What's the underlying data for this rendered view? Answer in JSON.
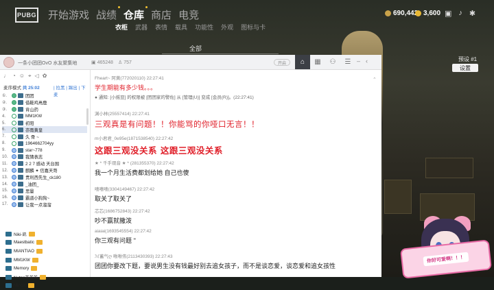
{
  "game": {
    "logo": "PUBG",
    "main_tabs": [
      "开始游戏",
      "战绩",
      "仓库",
      "商店",
      "电竞"
    ],
    "sub_tabs": [
      "衣柜",
      "武器",
      "表情",
      "载具",
      "功能性",
      "外观",
      "图标与卡"
    ],
    "currency_gold": "690,442",
    "currency_g": "3,600",
    "filter": "全部",
    "preset": "预设 #1",
    "settings": "设置"
  },
  "overlay": {
    "title": "一条小团团OvO 水友聚集地",
    "viewers": "465248",
    "fans": "757",
    "toggle": "开启",
    "mode_label": "麦序模式",
    "mode_value": "共 25:02",
    "links": "| 拉黑 | 踢出 | 下麦",
    "ranks": [
      {
        "no": "①.",
        "name": "团团"
      },
      {
        "no": "②.",
        "name": "借鞋鸡焉鹿"
      },
      {
        "no": "③.",
        "name": "肯山药"
      },
      {
        "no": "4.",
        "name": "MM1KW"
      },
      {
        "no": "5.",
        "name": "初阳"
      },
      {
        "no": "6.",
        "name": "亦雨黄皇"
      },
      {
        "no": "7.",
        "name": "久 骨 ~"
      },
      {
        "no": "8.",
        "name": "1964662704yy"
      },
      {
        "no": "9.",
        "name": "star~778"
      },
      {
        "no": "10.",
        "name": "我猜表志"
      },
      {
        "no": "11.",
        "name": "2 2 7 感动 天台围"
      },
      {
        "no": "12.",
        "name": "麒麟 ✦ 信嘉天哥"
      },
      {
        "no": "13.",
        "name": "贵利西先生_ck180"
      },
      {
        "no": "14.",
        "name": "_油团_"
      },
      {
        "no": "15.",
        "name": "思量"
      },
      {
        "no": "16.",
        "name": "霸道小狗狗~"
      },
      {
        "no": "17.",
        "name": "让我一点溜溜"
      }
    ],
    "fans_list": [
      "Niki-凯",
      "Maestbatic",
      "MIANTIAO",
      "MM1KW",
      "Memory",
      "Nuts♥羊羊羊",
      "Minoic"
    ]
  },
  "chat": {
    "messages": [
      {
        "meta": "Fheart~ 阿黄(772020110) 22:27:41",
        "text": "学生期能有多少钱。。。",
        "style": "red"
      },
      {
        "meta": "● 通知: [小摇豆] 的权限被 [团团家的警佐] 从 [管理(U)] 变成 [会员(R)]。(22:27:41)",
        "text": "",
        "style": "sys"
      },
      {
        "meta": "渊小林(25557414) 22:27:41",
        "text": "三观真是有问题！！你能骂的你哑口无言！！",
        "style": "red big"
      },
      {
        "meta": "m小君君_0e95e(1871538540) 22:27:42",
        "text": "这跟三观没关系 这跟三观没关系",
        "style": "red big bold"
      },
      {
        "meta": "★ * 千手观音 ★ * (281355370) 22:27:42",
        "text": "我一个月生活费都划给她 自己也傻",
        "style": "normal"
      },
      {
        "meta": "嘻嘻嘻(3304149467) 22:27:42",
        "text": "取关了取关了",
        "style": "normal"
      },
      {
        "meta": "芯芯(1686752843) 22:27:42",
        "text": "吵不赢就撒泼",
        "style": "normal"
      },
      {
        "meta": "aiaiai(1693545554) 22:27:42",
        "text": "你三观有问题 ''",
        "style": "normal"
      },
      {
        "meta": "ℳ蓄气ღ 啾啾伟(2113430393) 22:27:43",
        "text": "团团你要改下题，要说男生没有钱最好别去追女孩子，而不是谈恋爱，谈恋爱和追女孩性",
        "style": "normal"
      }
    ]
  },
  "cam": {
    "sign": "你好可爱啊！！！"
  }
}
